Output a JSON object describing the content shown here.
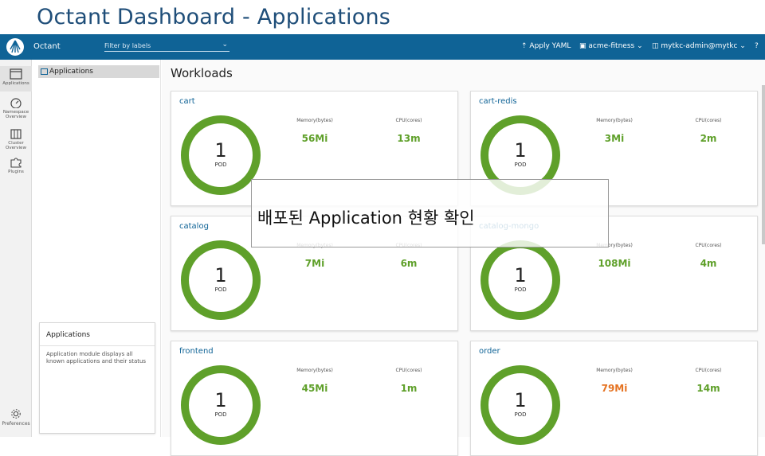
{
  "slide_title": "Octant Dashboard - Applications",
  "topbar": {
    "app_name": "Octant",
    "filter_placeholder": "Filter by labels",
    "apply_yaml": "Apply YAML",
    "namespace": "acme-fitness",
    "context": "mytkc-admin@mytkc"
  },
  "sidebar": {
    "applications": "Applications",
    "namespace_overview": "Namespace Overview",
    "cluster_overview": "Cluster Overview",
    "plugins": "Plugins",
    "preferences": "Preferences"
  },
  "subnav": {
    "item": "Applications"
  },
  "help": {
    "title": "Applications",
    "text": "Application module displays all known applications and their status"
  },
  "main": {
    "title": "Workloads",
    "memory_label": "Memory(bytes)",
    "cpu_label": "CPU(cores)",
    "pod_label": "POD"
  },
  "workloads": [
    {
      "name": "cart",
      "pods": "1",
      "memory": "56Mi",
      "cpu": "13m",
      "memory_status": "ok"
    },
    {
      "name": "cart-redis",
      "pods": "1",
      "memory": "3Mi",
      "cpu": "2m",
      "memory_status": "ok"
    },
    {
      "name": "catalog",
      "pods": "1",
      "memory": "7Mi",
      "cpu": "6m",
      "memory_status": "ok"
    },
    {
      "name": "catalog-mongo",
      "pods": "1",
      "memory": "108Mi",
      "cpu": "4m",
      "memory_status": "ok"
    },
    {
      "name": "frontend",
      "pods": "1",
      "memory": "45Mi",
      "cpu": "1m",
      "memory_status": "ok"
    },
    {
      "name": "order",
      "pods": "1",
      "memory": "79Mi",
      "cpu": "14m",
      "memory_status": "warn"
    }
  ],
  "overlay_caption": "배포된 Application 현황 확인",
  "colors": {
    "topbar": "#0f6396",
    "ring": "#5fa02a",
    "warn": "#e57322",
    "title": "#1f4e79"
  }
}
